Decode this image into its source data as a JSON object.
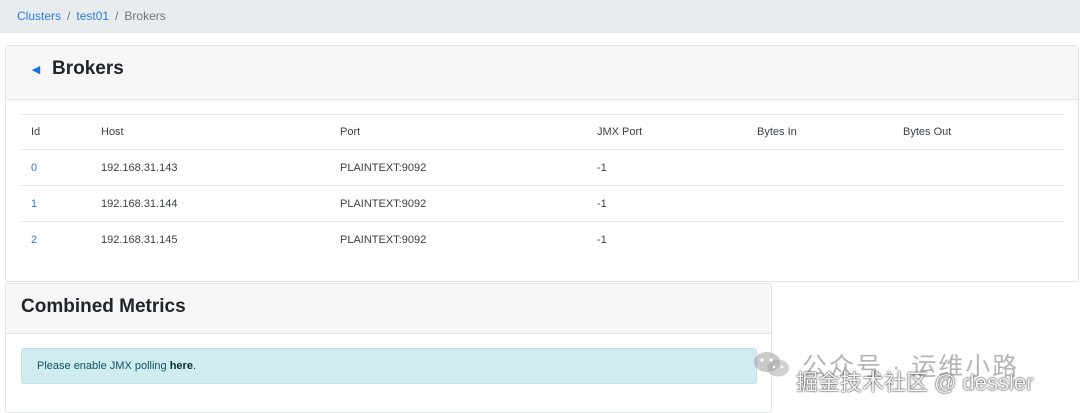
{
  "breadcrumb": {
    "items": [
      "Clusters",
      "test01"
    ],
    "current": "Brokers",
    "separator": "/"
  },
  "brokers_card": {
    "title": "Brokers",
    "columns": [
      "Id",
      "Host",
      "Port",
      "JMX Port",
      "Bytes In",
      "Bytes Out"
    ],
    "rows": [
      {
        "id": "0",
        "host": "192.168.31.143",
        "port": "PLAINTEXT:9092",
        "jmx_port": "-1",
        "bytes_in": "",
        "bytes_out": ""
      },
      {
        "id": "1",
        "host": "192.168.31.144",
        "port": "PLAINTEXT:9092",
        "jmx_port": "-1",
        "bytes_in": "",
        "bytes_out": ""
      },
      {
        "id": "2",
        "host": "192.168.31.145",
        "port": "PLAINTEXT:9092",
        "jmx_port": "-1",
        "bytes_in": "",
        "bytes_out": ""
      }
    ]
  },
  "metrics_card": {
    "title": "Combined Metrics",
    "alert_prefix": "Please enable JMX polling ",
    "alert_link": "here",
    "alert_suffix": "."
  },
  "watermark": {
    "line1": "公众号 · 运维小路",
    "line2": "掘金技术社区 @ dessler"
  },
  "colors": {
    "link": "#2a7ae2",
    "alert_bg": "#d1ecf1",
    "header_bg": "#e9ecef"
  }
}
